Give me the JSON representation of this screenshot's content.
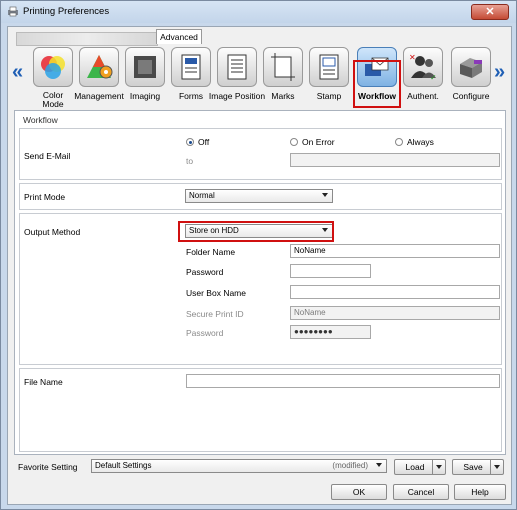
{
  "window": {
    "title": "Printing Preferences",
    "close_glyph": "✕"
  },
  "tabs": {
    "blurred": "",
    "advanced": "Advanced"
  },
  "icons": [
    {
      "label": "Color\nMode",
      "icon": "color-mode-icon"
    },
    {
      "label": "Management",
      "icon": "management-icon"
    },
    {
      "label": "Imaging",
      "icon": "imaging-icon"
    },
    {
      "label": "Forms",
      "icon": "forms-icon"
    },
    {
      "label": "Image Position",
      "icon": "image-position-icon"
    },
    {
      "label": "Marks",
      "icon": "marks-icon"
    },
    {
      "label": "Stamp",
      "icon": "stamp-icon"
    },
    {
      "label": "Workflow",
      "icon": "workflow-icon",
      "selected": true
    },
    {
      "label": "Authent.",
      "icon": "authentication-icon"
    },
    {
      "label": "Configure",
      "icon": "configure-icon"
    }
  ],
  "nav": {
    "left": "«",
    "right": "»"
  },
  "panel": {
    "title": "Workflow",
    "send_email": {
      "label": "Send E-Mail",
      "options": [
        "Off",
        "On Error",
        "Always"
      ],
      "selected": "Off",
      "to_label": "to",
      "to_value": ""
    },
    "print_mode": {
      "label": "Print Mode",
      "value": "Normal"
    },
    "output_method": {
      "label": "Output Method",
      "value": "Store on HDD",
      "folder_name_label": "Folder Name",
      "folder_name_value": "NoName",
      "password_label": "Password",
      "password_value": "",
      "user_box_name_label": "User Box Name",
      "user_box_name_value": "",
      "secure_print_id_label": "Secure Print ID",
      "secure_print_id_value": "NoName",
      "secure_password_label": "Password",
      "secure_password_value": "●●●●●●●●"
    },
    "file_name": {
      "label": "File Name",
      "value": ""
    }
  },
  "favorite": {
    "label": "Favorite Setting",
    "value": "Default Settings",
    "status": "(modified)",
    "load": "Load",
    "save": "Save"
  },
  "footer": {
    "ok": "OK",
    "cancel": "Cancel",
    "help": "Help"
  },
  "colors": {
    "accent": "#d01010",
    "title_bg": "#c8d8eb",
    "close_btn": "#c44a35"
  }
}
